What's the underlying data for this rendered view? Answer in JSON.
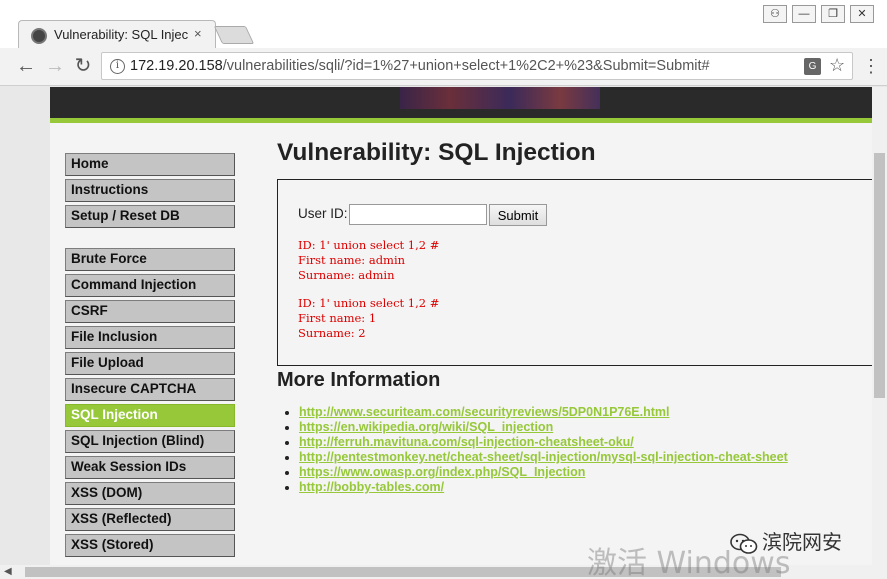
{
  "browser": {
    "tab_title": "Vulnerability: SQL Injec",
    "tab_close": "×",
    "url_host": "172.19.20.158",
    "url_path": "/vulnerabilities/sqli/?id=1%27+union+select+1%2C2+%23&Submit=Submit#",
    "translate_icon": "G",
    "star_icon": "☆",
    "menu_icon": "⋮",
    "info_icon": "i",
    "back_icon": "←",
    "forward_icon": "→",
    "reload_icon": "↻",
    "win_user": "⚇",
    "win_min": "—",
    "win_max": "❐",
    "win_close": "✕"
  },
  "sidebar": {
    "group1": [
      "Home",
      "Instructions",
      "Setup / Reset DB"
    ],
    "group2": [
      "Brute Force",
      "Command Injection",
      "CSRF",
      "File Inclusion",
      "File Upload",
      "Insecure CAPTCHA",
      "SQL Injection",
      "SQL Injection (Blind)",
      "Weak Session IDs",
      "XSS (DOM)",
      "XSS (Reflected)",
      "XSS (Stored)"
    ],
    "active": "SQL Injection"
  },
  "main": {
    "title": "Vulnerability: SQL Injection",
    "form": {
      "label": "User ID:",
      "input_value": "",
      "submit_label": "Submit"
    },
    "results": [
      "ID: 1' union select 1,2 #\nFirst name: admin\nSurname: admin",
      "ID: 1' union select 1,2 #\nFirst name: 1\nSurname: 2"
    ],
    "more_title": "More Information",
    "links": [
      "http://www.securiteam.com/securityreviews/5DP0N1P76E.html",
      "https://en.wikipedia.org/wiki/SQL_injection",
      "http://ferruh.mavituna.com/sql-injection-cheatsheet-oku/",
      "http://pentestmonkey.net/cheat-sheet/sql-injection/mysql-sql-injection-cheat-sheet",
      "https://www.owasp.org/index.php/SQL_Injection",
      "http://bobby-tables.com/"
    ]
  },
  "overlay": {
    "activate_windows": "激活 Windows",
    "brand": "滨院网安"
  },
  "colors": {
    "accent": "#96c83a",
    "result_text": "#dd0000"
  }
}
